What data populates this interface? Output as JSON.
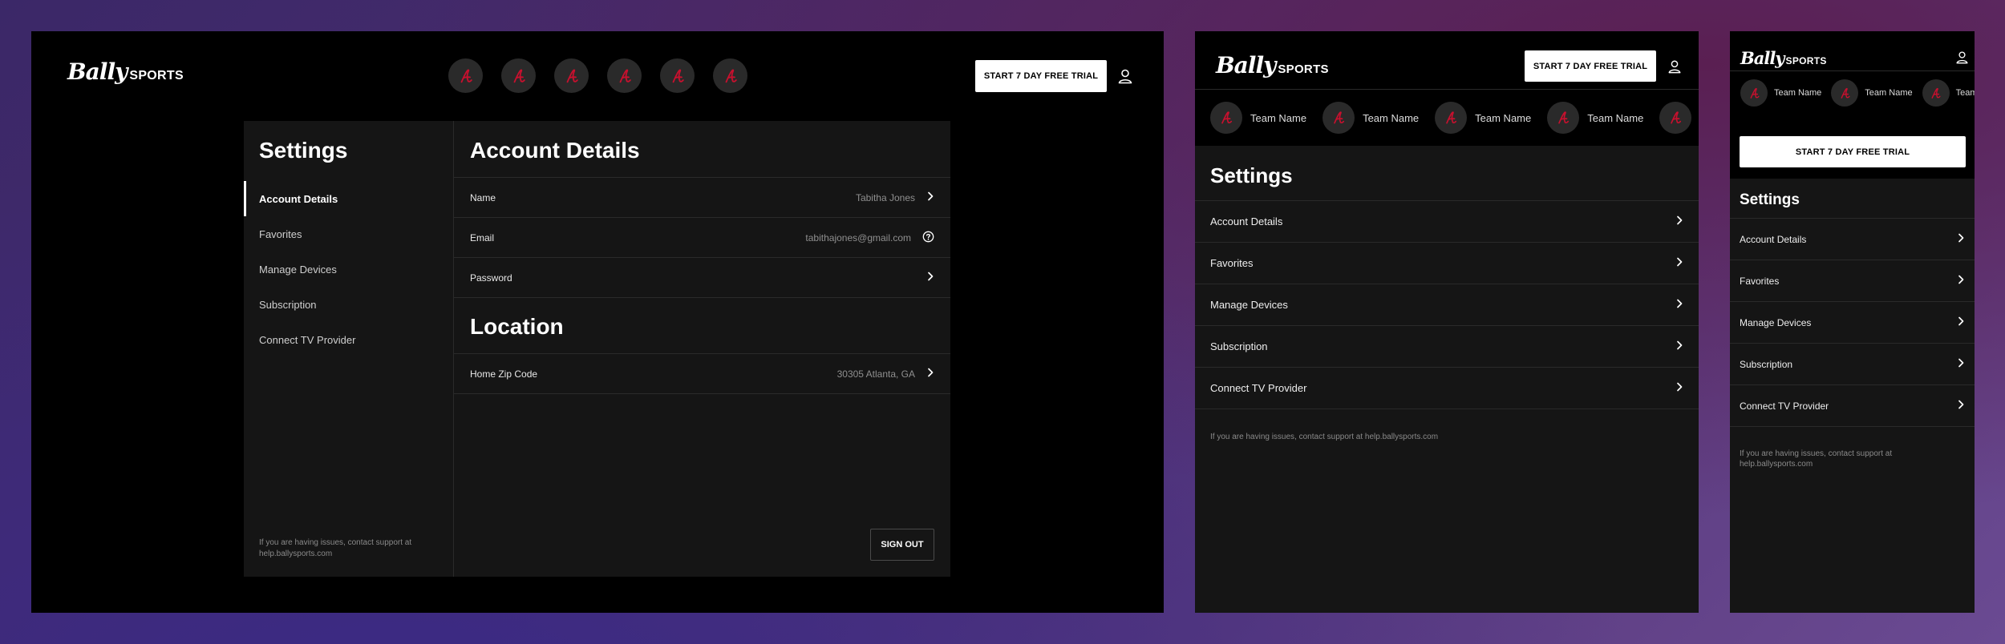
{
  "brand": {
    "logo_script": "Bally",
    "logo_caps": "SPORTS"
  },
  "cta": {
    "trial_label": "START 7 DAY FREE TRIAL"
  },
  "colors": {
    "team_logo": "#c8102e",
    "frame_bg": "#000000",
    "panel_bg": "#151515"
  },
  "icons": {
    "team_logo": "braves-a-icon",
    "user": "user-icon",
    "chevron": "chevron-right-icon",
    "help": "question-circle-icon"
  },
  "desktop": {
    "settings_title": "Settings",
    "nav": [
      {
        "label": "Account Details",
        "active": true
      },
      {
        "label": "Favorites",
        "active": false
      },
      {
        "label": "Manage Devices",
        "active": false
      },
      {
        "label": "Subscription",
        "active": false
      },
      {
        "label": "Connect TV Provider",
        "active": false
      }
    ],
    "support_text": "If you are having issues, contact support at help.ballysports.com",
    "account": {
      "title": "Account Details",
      "rows": [
        {
          "label": "Name",
          "value": "Tabitha Jones",
          "icon": "chevron-right-icon"
        },
        {
          "label": "Email",
          "value": "tabithajones@gmail.com",
          "icon": "question-circle-icon"
        },
        {
          "label": "Password",
          "value": "",
          "icon": "chevron-right-icon"
        }
      ]
    },
    "location": {
      "title": "Location",
      "rows": [
        {
          "label": "Home Zip Code",
          "value": "30305 Atlanta, GA",
          "icon": "chevron-right-icon"
        }
      ]
    },
    "sign_out_label": "SIGN OUT"
  },
  "tablet": {
    "teams": [
      "Team Name",
      "Team Name",
      "Team Name",
      "Team Name"
    ],
    "settings_title": "Settings",
    "list": [
      "Account Details",
      "Favorites",
      "Manage Devices",
      "Subscription",
      "Connect TV Provider"
    ],
    "support_text": "If you are having issues, contact support at help.ballysports.com"
  },
  "mobile": {
    "teams": [
      "Team Name",
      "Team Name",
      "Team Name"
    ],
    "settings_title": "Settings",
    "list": [
      "Account Details",
      "Favorites",
      "Manage Devices",
      "Subscription",
      "Connect TV Provider"
    ],
    "support_text": "If you are having issues, contact support at help.ballysports.com"
  }
}
